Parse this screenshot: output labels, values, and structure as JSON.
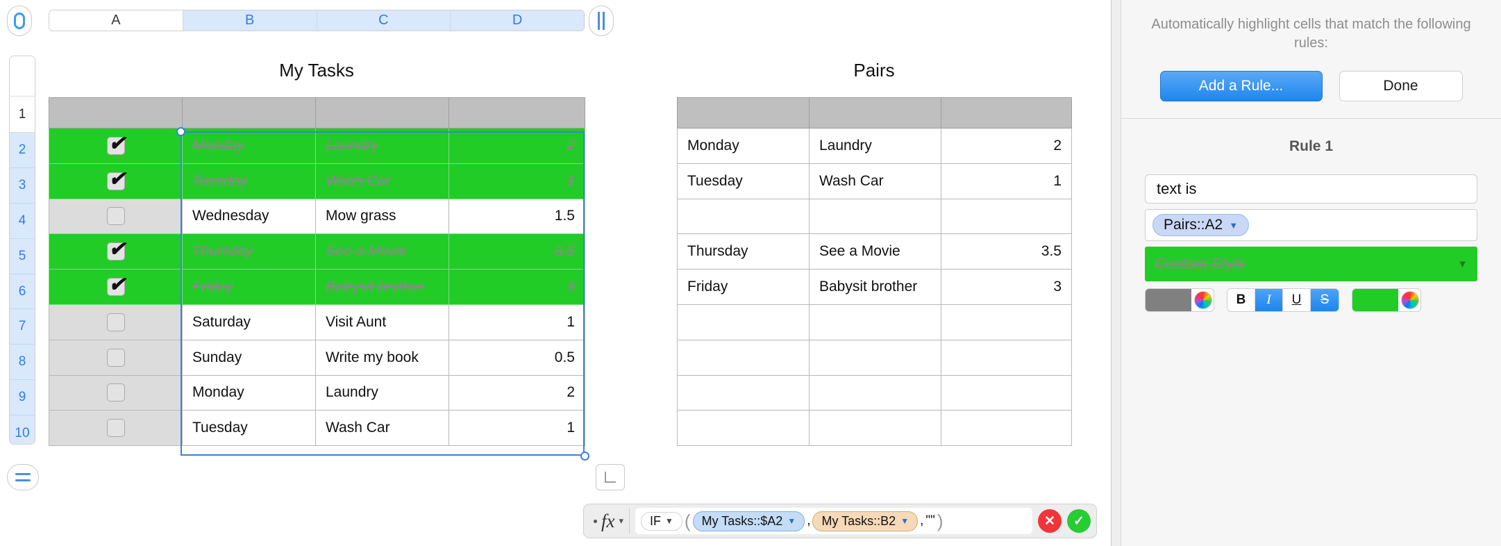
{
  "columns": [
    {
      "label": "A",
      "selected": false
    },
    {
      "label": "B",
      "selected": true
    },
    {
      "label": "C",
      "selected": true
    },
    {
      "label": "D",
      "selected": true
    }
  ],
  "rows": [
    "1",
    "2",
    "3",
    "4",
    "5",
    "6",
    "7",
    "8",
    "9",
    "10"
  ],
  "tables": [
    {
      "title": "My Tasks",
      "rows": [
        {
          "checked": true,
          "done": true,
          "day": "Monday",
          "task": "Laundry",
          "hours": "2"
        },
        {
          "checked": true,
          "done": true,
          "day": "Tuesday",
          "task": "Wash Car",
          "hours": "1"
        },
        {
          "checked": false,
          "done": false,
          "day": "Wednesday",
          "task": "Mow grass",
          "hours": "1.5"
        },
        {
          "checked": true,
          "done": true,
          "day": "Thursday",
          "task": "See a Movie",
          "hours": "3.5"
        },
        {
          "checked": true,
          "done": true,
          "day": "Friday",
          "task": "Babysit brother",
          "hours": "3"
        },
        {
          "checked": false,
          "done": false,
          "day": "Saturday",
          "task": "Visit Aunt",
          "hours": "1"
        },
        {
          "checked": false,
          "done": false,
          "day": "Sunday",
          "task": "Write my book",
          "hours": "0.5"
        },
        {
          "checked": false,
          "done": false,
          "day": "Monday",
          "task": "Laundry",
          "hours": "2"
        },
        {
          "checked": false,
          "done": false,
          "day": "Tuesday",
          "task": "Wash Car",
          "hours": "1"
        }
      ]
    },
    {
      "title": "Pairs",
      "rows": [
        {
          "day": "Monday",
          "task": "Laundry",
          "hours": "2"
        },
        {
          "day": "Tuesday",
          "task": "Wash Car",
          "hours": "1"
        },
        {
          "day": "",
          "task": "",
          "hours": ""
        },
        {
          "day": "Thursday",
          "task": "See a Movie",
          "hours": "3.5"
        },
        {
          "day": "Friday",
          "task": "Babysit brother",
          "hours": "3"
        },
        {
          "day": "",
          "task": "",
          "hours": ""
        },
        {
          "day": "",
          "task": "",
          "hours": ""
        },
        {
          "day": "",
          "task": "",
          "hours": ""
        },
        {
          "day": "",
          "task": "",
          "hours": ""
        }
      ]
    }
  ],
  "formula_bar": {
    "fx_label": "fx",
    "function_name": "IF",
    "arg1": "My Tasks::$A2",
    "arg2": "My Tasks::B2",
    "arg3": "\"\"",
    "comma": ",",
    "open_paren": "(",
    "close_paren": ")",
    "cancel_label": "✕",
    "accept_label": "✓"
  },
  "panel": {
    "description": "Automatically highlight cells that match the following rules:",
    "add_rule_label": "Add a Rule...",
    "done_label": "Done",
    "rule_title": "Rule 1",
    "condition": "text is",
    "reference": "Pairs::A2",
    "style_name": "Custom Style",
    "text_color": "#808080",
    "fill_color": "#22cc26",
    "format_toggles": [
      {
        "name": "bold",
        "label": "B",
        "on": false
      },
      {
        "name": "italic",
        "label": "I",
        "on": true
      },
      {
        "name": "underline",
        "label": "U",
        "on": false
      },
      {
        "name": "strikethrough",
        "label": "S",
        "on": true
      }
    ]
  }
}
